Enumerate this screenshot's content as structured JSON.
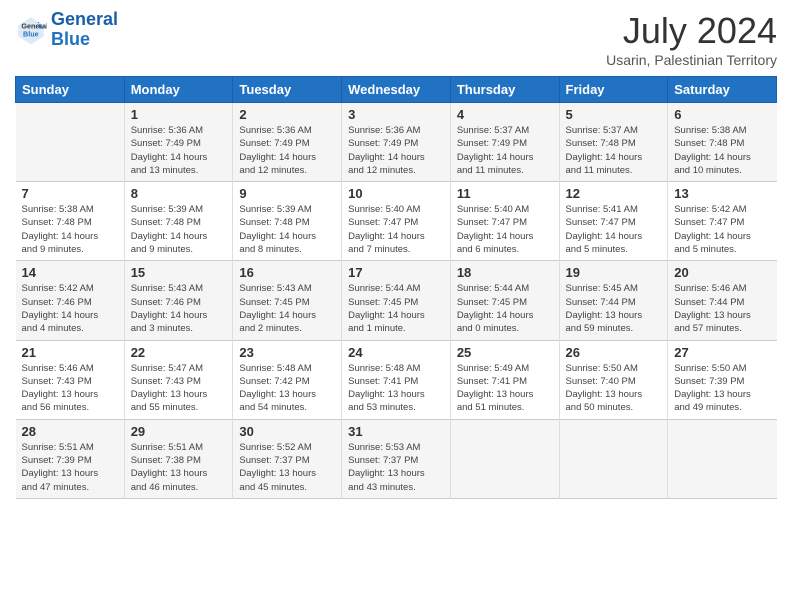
{
  "header": {
    "logo_general": "General",
    "logo_blue": "Blue",
    "month_title": "July 2024",
    "location": "Usarin, Palestinian Territory"
  },
  "columns": [
    "Sunday",
    "Monday",
    "Tuesday",
    "Wednesday",
    "Thursday",
    "Friday",
    "Saturday"
  ],
  "weeks": [
    [
      {
        "day": "",
        "info": ""
      },
      {
        "day": "1",
        "info": "Sunrise: 5:36 AM\nSunset: 7:49 PM\nDaylight: 14 hours\nand 13 minutes."
      },
      {
        "day": "2",
        "info": "Sunrise: 5:36 AM\nSunset: 7:49 PM\nDaylight: 14 hours\nand 12 minutes."
      },
      {
        "day": "3",
        "info": "Sunrise: 5:36 AM\nSunset: 7:49 PM\nDaylight: 14 hours\nand 12 minutes."
      },
      {
        "day": "4",
        "info": "Sunrise: 5:37 AM\nSunset: 7:49 PM\nDaylight: 14 hours\nand 11 minutes."
      },
      {
        "day": "5",
        "info": "Sunrise: 5:37 AM\nSunset: 7:48 PM\nDaylight: 14 hours\nand 11 minutes."
      },
      {
        "day": "6",
        "info": "Sunrise: 5:38 AM\nSunset: 7:48 PM\nDaylight: 14 hours\nand 10 minutes."
      }
    ],
    [
      {
        "day": "7",
        "info": "Sunrise: 5:38 AM\nSunset: 7:48 PM\nDaylight: 14 hours\nand 9 minutes."
      },
      {
        "day": "8",
        "info": "Sunrise: 5:39 AM\nSunset: 7:48 PM\nDaylight: 14 hours\nand 9 minutes."
      },
      {
        "day": "9",
        "info": "Sunrise: 5:39 AM\nSunset: 7:48 PM\nDaylight: 14 hours\nand 8 minutes."
      },
      {
        "day": "10",
        "info": "Sunrise: 5:40 AM\nSunset: 7:47 PM\nDaylight: 14 hours\nand 7 minutes."
      },
      {
        "day": "11",
        "info": "Sunrise: 5:40 AM\nSunset: 7:47 PM\nDaylight: 14 hours\nand 6 minutes."
      },
      {
        "day": "12",
        "info": "Sunrise: 5:41 AM\nSunset: 7:47 PM\nDaylight: 14 hours\nand 5 minutes."
      },
      {
        "day": "13",
        "info": "Sunrise: 5:42 AM\nSunset: 7:47 PM\nDaylight: 14 hours\nand 5 minutes."
      }
    ],
    [
      {
        "day": "14",
        "info": "Sunrise: 5:42 AM\nSunset: 7:46 PM\nDaylight: 14 hours\nand 4 minutes."
      },
      {
        "day": "15",
        "info": "Sunrise: 5:43 AM\nSunset: 7:46 PM\nDaylight: 14 hours\nand 3 minutes."
      },
      {
        "day": "16",
        "info": "Sunrise: 5:43 AM\nSunset: 7:45 PM\nDaylight: 14 hours\nand 2 minutes."
      },
      {
        "day": "17",
        "info": "Sunrise: 5:44 AM\nSunset: 7:45 PM\nDaylight: 14 hours\nand 1 minute."
      },
      {
        "day": "18",
        "info": "Sunrise: 5:44 AM\nSunset: 7:45 PM\nDaylight: 14 hours\nand 0 minutes."
      },
      {
        "day": "19",
        "info": "Sunrise: 5:45 AM\nSunset: 7:44 PM\nDaylight: 13 hours\nand 59 minutes."
      },
      {
        "day": "20",
        "info": "Sunrise: 5:46 AM\nSunset: 7:44 PM\nDaylight: 13 hours\nand 57 minutes."
      }
    ],
    [
      {
        "day": "21",
        "info": "Sunrise: 5:46 AM\nSunset: 7:43 PM\nDaylight: 13 hours\nand 56 minutes."
      },
      {
        "day": "22",
        "info": "Sunrise: 5:47 AM\nSunset: 7:43 PM\nDaylight: 13 hours\nand 55 minutes."
      },
      {
        "day": "23",
        "info": "Sunrise: 5:48 AM\nSunset: 7:42 PM\nDaylight: 13 hours\nand 54 minutes."
      },
      {
        "day": "24",
        "info": "Sunrise: 5:48 AM\nSunset: 7:41 PM\nDaylight: 13 hours\nand 53 minutes."
      },
      {
        "day": "25",
        "info": "Sunrise: 5:49 AM\nSunset: 7:41 PM\nDaylight: 13 hours\nand 51 minutes."
      },
      {
        "day": "26",
        "info": "Sunrise: 5:50 AM\nSunset: 7:40 PM\nDaylight: 13 hours\nand 50 minutes."
      },
      {
        "day": "27",
        "info": "Sunrise: 5:50 AM\nSunset: 7:39 PM\nDaylight: 13 hours\nand 49 minutes."
      }
    ],
    [
      {
        "day": "28",
        "info": "Sunrise: 5:51 AM\nSunset: 7:39 PM\nDaylight: 13 hours\nand 47 minutes."
      },
      {
        "day": "29",
        "info": "Sunrise: 5:51 AM\nSunset: 7:38 PM\nDaylight: 13 hours\nand 46 minutes."
      },
      {
        "day": "30",
        "info": "Sunrise: 5:52 AM\nSunset: 7:37 PM\nDaylight: 13 hours\nand 45 minutes."
      },
      {
        "day": "31",
        "info": "Sunrise: 5:53 AM\nSunset: 7:37 PM\nDaylight: 13 hours\nand 43 minutes."
      },
      {
        "day": "",
        "info": ""
      },
      {
        "day": "",
        "info": ""
      },
      {
        "day": "",
        "info": ""
      }
    ]
  ]
}
